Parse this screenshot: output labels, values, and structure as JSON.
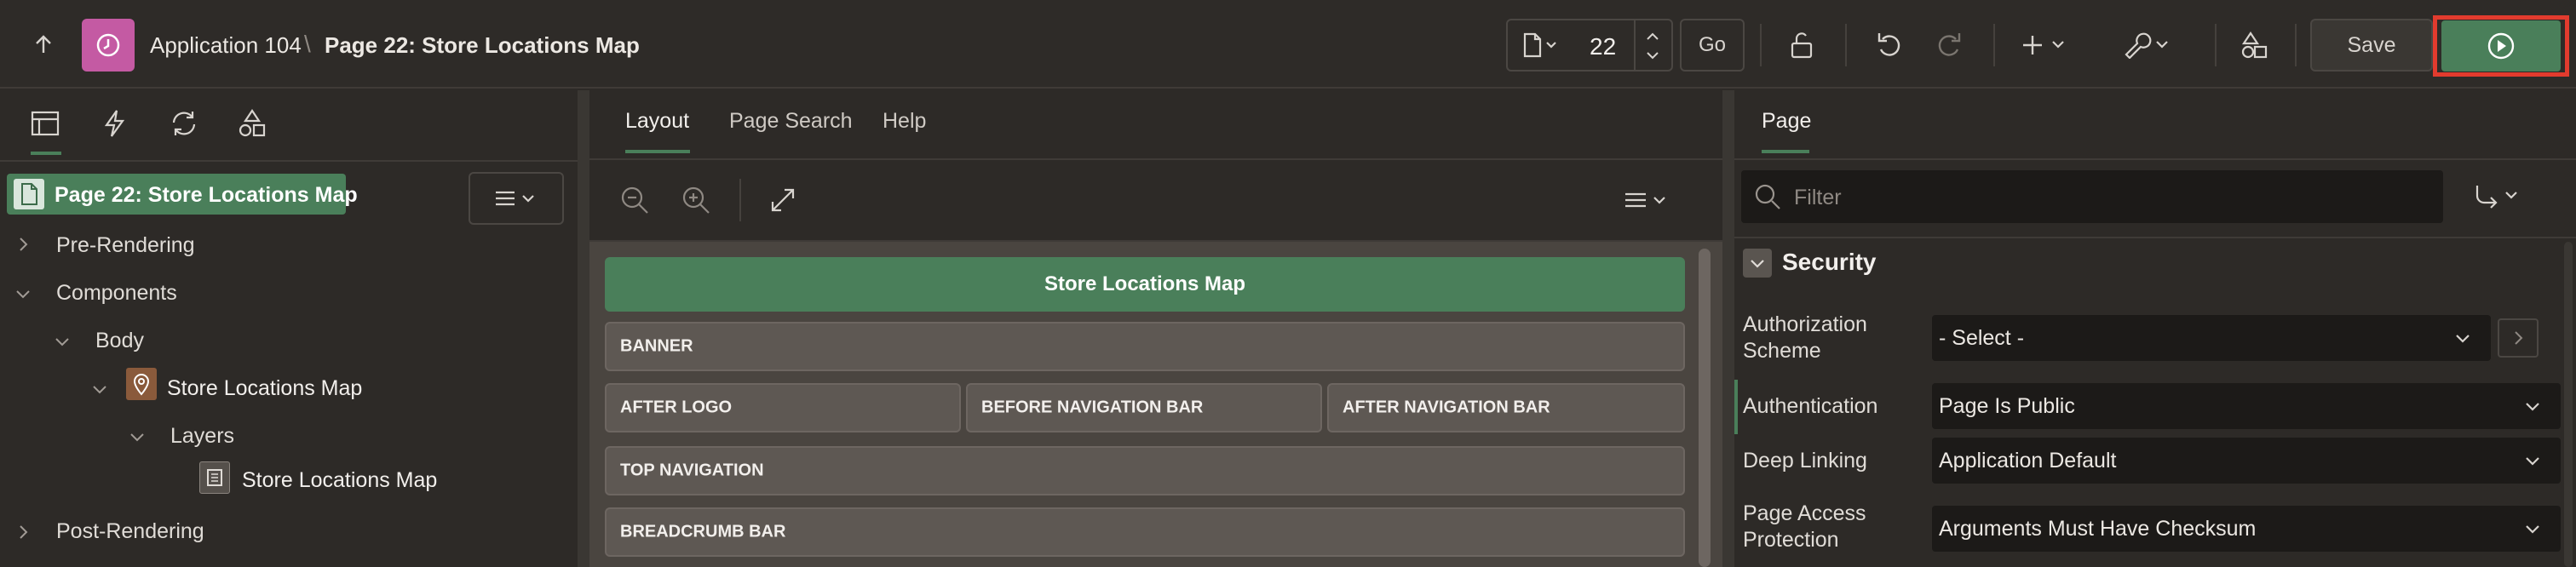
{
  "header": {
    "app_name": "Application 104",
    "separator": "\\",
    "page_title": "Page 22: Store Locations Map",
    "page_number": "22",
    "go_label": "Go",
    "save_label": "Save"
  },
  "left": {
    "tree": {
      "root": "Page 22: Store Locations Map",
      "pre_rendering": "Pre-Rendering",
      "components": "Components",
      "body": "Body",
      "region": "Store Locations Map",
      "layers": "Layers",
      "layer_item": "Store Locations Map",
      "post_rendering": "Post-Rendering"
    }
  },
  "center": {
    "tabs": [
      "Layout",
      "Page Search",
      "Help"
    ],
    "page_title_bar": "Store Locations Map",
    "regions": {
      "banner": "BANNER",
      "after_logo": "AFTER LOGO",
      "before_nav_bar": "BEFORE NAVIGATION BAR",
      "after_nav_bar": "AFTER NAVIGATION BAR",
      "top_navigation": "TOP NAVIGATION",
      "breadcrumb_bar": "BREADCRUMB BAR"
    }
  },
  "right": {
    "tab": "Page",
    "filter_placeholder": "Filter",
    "section_title": "Security",
    "properties": {
      "authorization_scheme_label": "Authorization Scheme",
      "authorization_scheme_value": "- Select -",
      "authentication_label": "Authentication",
      "authentication_value": "Page Is Public",
      "deep_linking_label": "Deep Linking",
      "deep_linking_value": "Application Default",
      "page_access_label": "Page Access Protection",
      "page_access_value": "Arguments Must Have Checksum"
    }
  },
  "colors": {
    "accent_green": "#4a7f5a",
    "highlight_red": "#e23b2e",
    "app_icon_pink": "#c45aa3"
  }
}
